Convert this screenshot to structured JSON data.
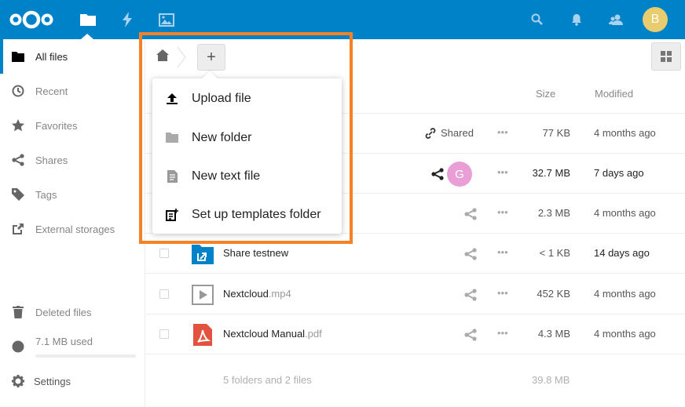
{
  "header": {
    "apps": [
      {
        "name": "files",
        "icon": "folder-icon",
        "active": true
      },
      {
        "name": "activity",
        "icon": "lightning-icon"
      },
      {
        "name": "gallery",
        "icon": "image-icon"
      }
    ],
    "right_icons": [
      "search-icon",
      "bell-icon",
      "contacts-icon"
    ],
    "avatar_initial": "B",
    "brand_color": "#0082c9"
  },
  "sidebar": {
    "items": [
      {
        "label": "All files",
        "icon": "folder-icon",
        "active": true
      },
      {
        "label": "Recent",
        "icon": "clock-icon"
      },
      {
        "label": "Favorites",
        "icon": "star-icon"
      },
      {
        "label": "Shares",
        "icon": "share-icon"
      },
      {
        "label": "Tags",
        "icon": "tag-icon"
      },
      {
        "label": "External storages",
        "icon": "external-link-icon"
      }
    ],
    "bottom": {
      "deleted_files": "Deleted files",
      "quota_label": "7.1 MB used",
      "quota_fraction": 0.0,
      "settings": "Settings"
    }
  },
  "new_menu": {
    "items": [
      {
        "label": "Upload file",
        "icon": "upload-icon"
      },
      {
        "label": "New folder",
        "icon": "folder-icon"
      },
      {
        "label": "New text file",
        "icon": "text-file-icon"
      },
      {
        "label": "Set up templates folder",
        "icon": "template-icon"
      }
    ]
  },
  "table": {
    "headers": {
      "size": "Size",
      "modified": "Modified"
    },
    "rows": [
      {
        "name": "",
        "ext": "",
        "shared_label": "Shared",
        "more": "•••",
        "size": "77 KB",
        "modified": "4 months ago"
      },
      {
        "name": "",
        "ext": "",
        "sharee_initial": "G",
        "more": "•••",
        "size": "32.7 MB",
        "modified": "7 days ago"
      },
      {
        "name": "",
        "ext": "",
        "more": "•••",
        "size": "2.3 MB",
        "modified": "4 months ago"
      },
      {
        "name": "Share testnew",
        "ext": "",
        "more": "•••",
        "size": "< 1 KB",
        "modified": "14 days ago"
      },
      {
        "name": "Nextcloud",
        "ext": ".mp4",
        "more": "•••",
        "size": "452 KB",
        "modified": "4 months ago"
      },
      {
        "name": "Nextcloud Manual",
        "ext": ".pdf",
        "more": "•••",
        "size": "4.3 MB",
        "modified": "4 months ago"
      }
    ],
    "footer": {
      "summary": "5 folders and 2 files",
      "total": "39.8 MB"
    }
  }
}
